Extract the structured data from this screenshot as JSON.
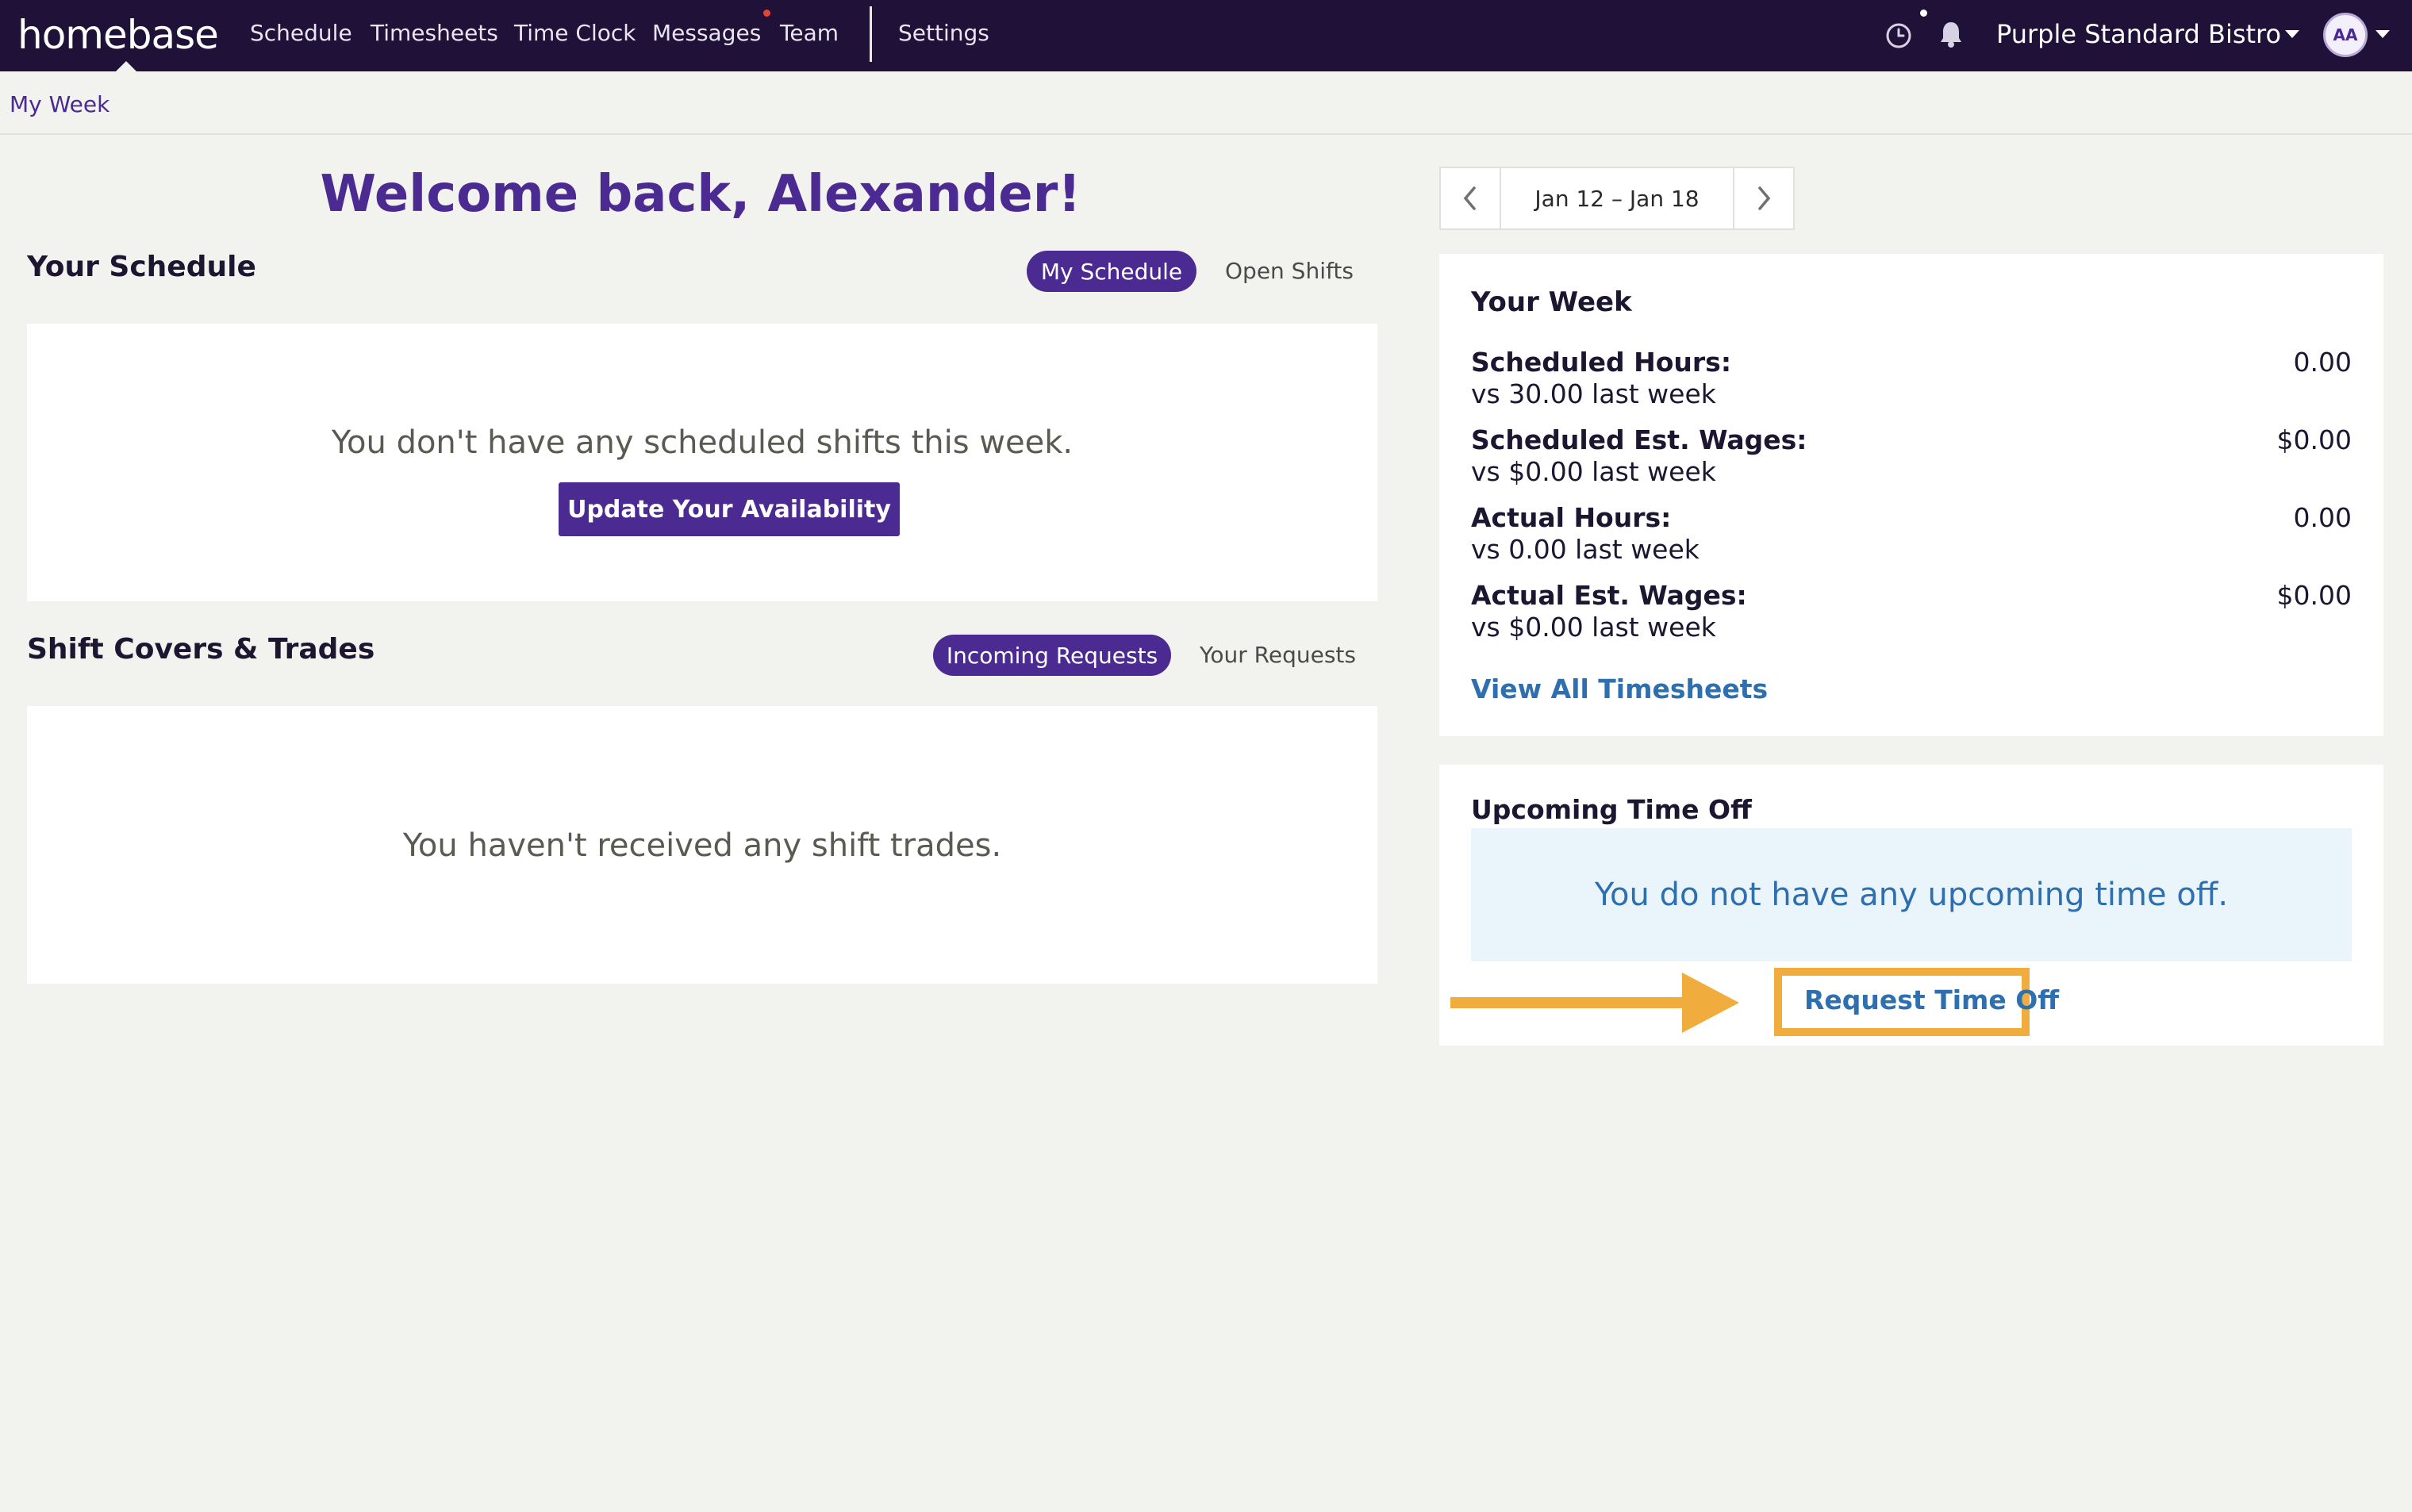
{
  "topbar": {
    "logo": "homebase",
    "nav": [
      "Schedule",
      "Timesheets",
      "Time Clock",
      "Messages",
      "Team",
      "Settings"
    ],
    "location": "Purple Standard Bistro",
    "avatar_initials": "AA",
    "icons": {
      "clock": "clock-icon",
      "bell": "bell-icon"
    }
  },
  "breadcrumb": "My Week",
  "welcome": "Welcome back, Alexander!",
  "schedule": {
    "title": "Your Schedule",
    "tab_active": "My Schedule",
    "tab_other": "Open Shifts",
    "empty": "You don't have any scheduled shifts this week.",
    "button": "Update Your Availability"
  },
  "trades": {
    "title": "Shift Covers & Trades",
    "tab_active": "Incoming Requests",
    "tab_other": "Your Requests",
    "empty": "You haven't received any shift trades."
  },
  "week_picker": {
    "label": "Jan 12 – Jan 18"
  },
  "your_week": {
    "title": "Your Week",
    "stats": [
      {
        "label": "Scheduled Hours:",
        "compare": "vs 30.00 last week",
        "value": "0.00"
      },
      {
        "label": "Scheduled Est. Wages:",
        "compare": "vs $0.00 last week",
        "value": "$0.00"
      },
      {
        "label": "Actual Hours:",
        "compare": "vs 0.00 last week",
        "value": "0.00"
      },
      {
        "label": "Actual Est. Wages:",
        "compare": "vs $0.00 last week",
        "value": "$0.00"
      }
    ],
    "link": "View All Timesheets"
  },
  "time_off": {
    "title": "Upcoming Time Off",
    "empty": "You do not have any upcoming time off.",
    "link": "Request Time Off"
  },
  "colors": {
    "nav_bg": "#1f1138",
    "brand_purple": "#4b2b91",
    "link_blue": "#2e6fb0",
    "annotation_orange": "#f0ad3e",
    "page_bg": "#f2f2ee"
  }
}
